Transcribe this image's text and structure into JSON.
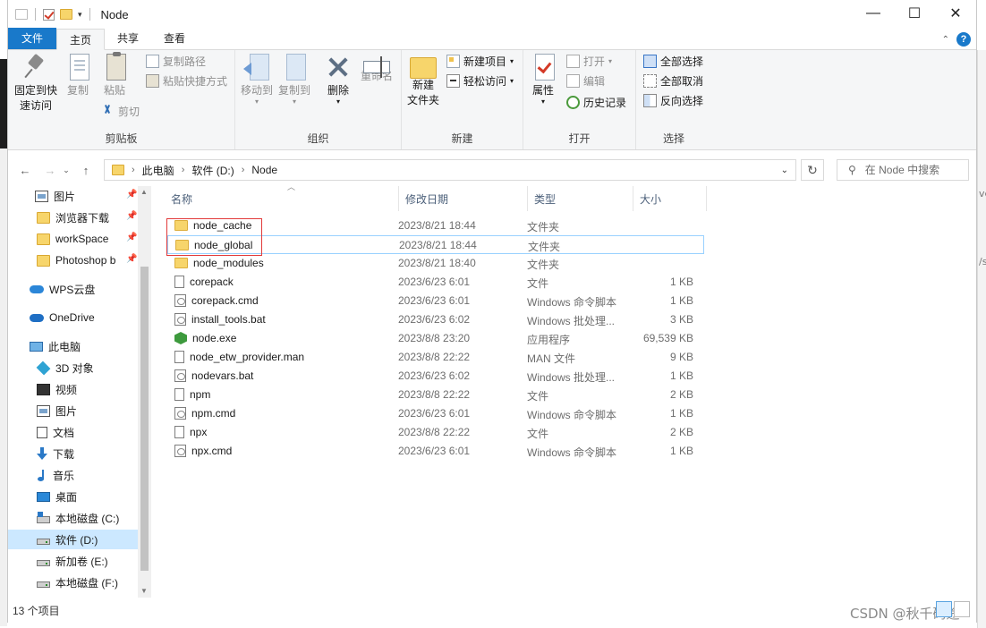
{
  "window": {
    "title": "Node"
  },
  "ribbon_tabs": [
    "文件",
    "主页",
    "共享",
    "查看"
  ],
  "ribbon": {
    "clipboard": {
      "label": "剪贴板",
      "pin": "固定到快速访问",
      "pin_line1": "固定到快",
      "pin_line2": "速访问",
      "copy": "复制",
      "paste": "粘贴",
      "copy_path": "复制路径",
      "paste_shortcut": "粘贴快捷方式",
      "cut": "剪切"
    },
    "organize": {
      "label": "组织",
      "move_to": "移动到",
      "copy_to": "复制到",
      "delete": "删除",
      "rename": "重命名"
    },
    "new": {
      "label": "新建",
      "new_item": "新建项目",
      "easy_access": "轻松访问",
      "new_folder_line1": "新建",
      "new_folder_line2": "文件夹"
    },
    "open": {
      "label": "打开",
      "properties": "属性",
      "open": "打开",
      "edit": "编辑",
      "history": "历史记录"
    },
    "select": {
      "label": "选择",
      "select_all": "全部选择",
      "select_none": "全部取消",
      "invert": "反向选择"
    }
  },
  "address": {
    "crumbs": [
      "此电脑",
      "软件 (D:)",
      "Node"
    ]
  },
  "search": {
    "placeholder": "在 Node 中搜索"
  },
  "sidebar": {
    "items": [
      {
        "label": "图片",
        "icon": "picture-icon",
        "pinned": true
      },
      {
        "label": "浏览器下载",
        "icon": "folder-icon",
        "pinned": true
      },
      {
        "label": "workSpace",
        "icon": "folder-icon",
        "pinned": true
      },
      {
        "label": "Photoshop b",
        "icon": "folder-icon",
        "pinned": true
      },
      {
        "label": "WPS云盘",
        "icon": "cloud-icon"
      },
      {
        "label": "OneDrive",
        "icon": "onedrive-icon"
      },
      {
        "label": "此电脑",
        "icon": "computer-icon"
      },
      {
        "label": "3D 对象",
        "icon": "3d-objects-icon"
      },
      {
        "label": "视频",
        "icon": "video-icon"
      },
      {
        "label": "图片",
        "icon": "picture-icon"
      },
      {
        "label": "文档",
        "icon": "document-icon"
      },
      {
        "label": "下载",
        "icon": "download-icon"
      },
      {
        "label": "音乐",
        "icon": "music-icon"
      },
      {
        "label": "桌面",
        "icon": "desktop-icon"
      },
      {
        "label": "本地磁盘 (C:)",
        "icon": "drive-c-icon"
      },
      {
        "label": "软件 (D:)",
        "icon": "drive-icon",
        "selected": true
      },
      {
        "label": "新加卷 (E:)",
        "icon": "drive-icon"
      },
      {
        "label": "本地磁盘 (F:)",
        "icon": "drive-icon"
      }
    ]
  },
  "columns": {
    "name": "名称",
    "date": "修改日期",
    "type": "类型",
    "size": "大小"
  },
  "files": [
    {
      "name": "node_cache",
      "date": "2023/8/21 18:44",
      "type": "文件夹",
      "size": "",
      "icon": "folder-icon"
    },
    {
      "name": "node_global",
      "date": "2023/8/21 18:44",
      "type": "文件夹",
      "size": "",
      "icon": "folder-icon"
    },
    {
      "name": "node_modules",
      "date": "2023/8/21 18:40",
      "type": "文件夹",
      "size": "",
      "icon": "folder-icon"
    },
    {
      "name": "corepack",
      "date": "2023/6/23 6:01",
      "type": "文件",
      "size": "1 KB",
      "icon": "file-icon"
    },
    {
      "name": "corepack.cmd",
      "date": "2023/6/23 6:01",
      "type": "Windows 命令脚本",
      "size": "1 KB",
      "icon": "script-icon"
    },
    {
      "name": "install_tools.bat",
      "date": "2023/6/23 6:02",
      "type": "Windows 批处理...",
      "size": "3 KB",
      "icon": "script-icon"
    },
    {
      "name": "node.exe",
      "date": "2023/8/8 23:20",
      "type": "应用程序",
      "size": "69,539 KB",
      "icon": "node-exe-icon"
    },
    {
      "name": "node_etw_provider.man",
      "date": "2023/8/8 22:22",
      "type": "MAN 文件",
      "size": "9 KB",
      "icon": "file-icon"
    },
    {
      "name": "nodevars.bat",
      "date": "2023/6/23 6:02",
      "type": "Windows 批处理...",
      "size": "1 KB",
      "icon": "script-icon"
    },
    {
      "name": "npm",
      "date": "2023/8/8 22:22",
      "type": "文件",
      "size": "2 KB",
      "icon": "file-icon"
    },
    {
      "name": "npm.cmd",
      "date": "2023/6/23 6:01",
      "type": "Windows 命令脚本",
      "size": "1 KB",
      "icon": "script-icon"
    },
    {
      "name": "npx",
      "date": "2023/8/8 22:22",
      "type": "文件",
      "size": "2 KB",
      "icon": "file-icon"
    },
    {
      "name": "npx.cmd",
      "date": "2023/6/23 6:01",
      "type": "Windows 命令脚本",
      "size": "1 KB",
      "icon": "script-icon"
    }
  ],
  "status": {
    "count": "13 个项目"
  },
  "watermark": "CSDN @秋千码途",
  "colors": {
    "file_tab": "#1979ca",
    "highlight_border": "#e23a3a",
    "selection": "#cce8ff"
  }
}
